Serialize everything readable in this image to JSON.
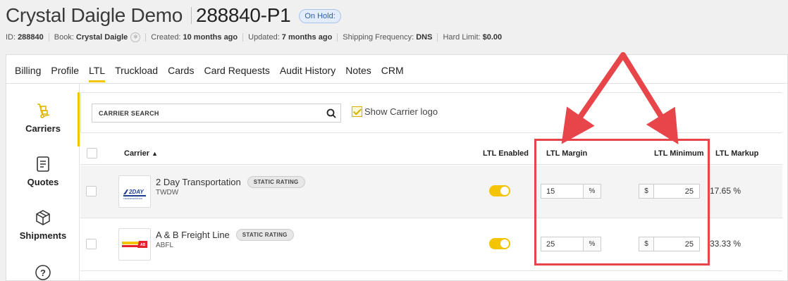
{
  "header": {
    "title": "Crystal Daigle Demo",
    "order_id": "288840-P1",
    "status_badge": "On Hold:"
  },
  "meta": {
    "id_label": "ID:",
    "id_value": "288840",
    "book_label": "Book:",
    "book_value": "Crystal Daigle",
    "created_label": "Created:",
    "created_value": "10 months ago",
    "updated_label": "Updated:",
    "updated_value": "7 months ago",
    "shipping_label": "Shipping Frequency:",
    "shipping_value": "DNS",
    "limit_label": "Hard Limit:",
    "limit_value": "$0.00"
  },
  "tabs": [
    "Billing",
    "Profile",
    "LTL",
    "Truckload",
    "Cards",
    "Card Requests",
    "Audit History",
    "Notes",
    "CRM"
  ],
  "active_tab": "LTL",
  "sidenav": {
    "carriers": "Carriers",
    "quotes": "Quotes",
    "shipments": "Shipments"
  },
  "search": {
    "placeholder": "CARRIER SEARCH",
    "show_logo_label": "Show Carrier logo"
  },
  "table": {
    "headers": {
      "carrier": "Carrier",
      "ltl_enabled": "LTL Enabled",
      "ltl_margin": "LTL Margin",
      "ltl_minimum": "LTL Minimum",
      "ltl_markup": "LTL Markup"
    },
    "rows": [
      {
        "name": "2 Day Transportation",
        "badge": "STATIC RATING",
        "code": "TWDW",
        "enabled": true,
        "margin": "15",
        "margin_unit": "%",
        "minimum_unit": "$",
        "minimum": "25",
        "markup": "17.65 %"
      },
      {
        "name": "A & B Freight Line",
        "badge": "STATIC RATING",
        "code": "ABFL",
        "enabled": true,
        "margin": "25",
        "margin_unit": "%",
        "minimum_unit": "$",
        "minimum": "25",
        "markup": "33.33 %"
      }
    ]
  },
  "colors": {
    "accent": "#f5c400",
    "annotation": "#e8454a",
    "badge_bg": "#e3ecfa"
  }
}
